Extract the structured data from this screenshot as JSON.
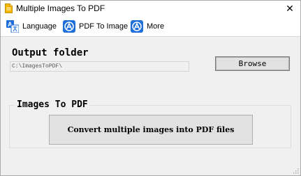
{
  "window": {
    "title": "Multiple Images To PDF",
    "close_glyph": "✕"
  },
  "menu": {
    "items": [
      {
        "label": "Language",
        "icon": "language-icon"
      },
      {
        "label": "PDF To Image",
        "icon": "app-icon"
      },
      {
        "label": "More",
        "icon": "app-icon"
      }
    ]
  },
  "output": {
    "label": "Output folder",
    "path_value": "C:\\ImagesToPDF\\",
    "browse_label": "Browse"
  },
  "images_to_pdf": {
    "group_label": "Images To PDF",
    "convert_label": "Convert multiple images into PDF files"
  },
  "colors": {
    "accent_blue": "#1e6fd9",
    "title_icon_yellow": "#f5b800"
  }
}
